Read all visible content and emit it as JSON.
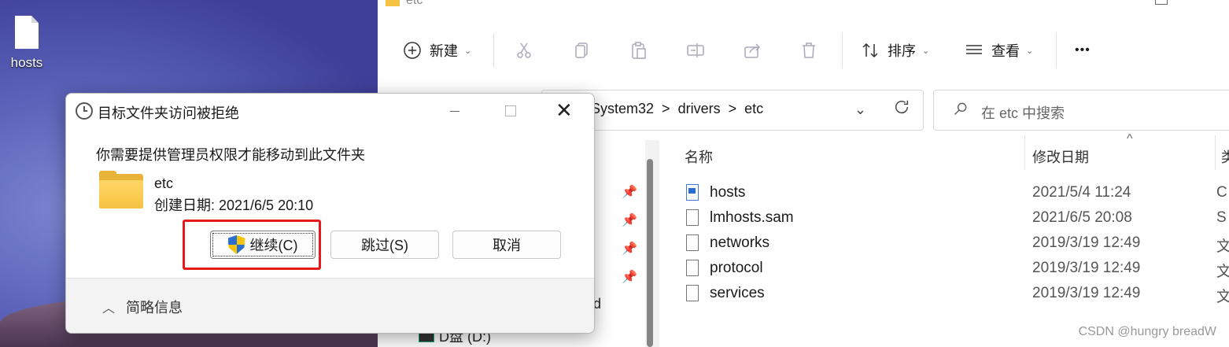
{
  "desktop": {
    "icon_label": "hosts"
  },
  "explorer": {
    "window_title": "etc",
    "toolbar": {
      "new_label": "新建",
      "sort_label": "排序",
      "view_label": "查看",
      "more_label": "•••"
    },
    "address": {
      "crumbs": [
        "System32",
        "drivers",
        "etc"
      ],
      "separator": ">"
    },
    "search": {
      "placeholder": "在 etc 中搜索"
    },
    "nav_partial": [
      "d",
      "D盘 (D:)"
    ],
    "columns": {
      "name": "名称",
      "modified": "修改日期",
      "type": "类"
    },
    "files": [
      {
        "name": "hosts",
        "modified": "2021/5/4 11:24",
        "type": "C",
        "icon": "hosts-file-icon"
      },
      {
        "name": "lmhosts.sam",
        "modified": "2021/6/5 20:08",
        "type": "S",
        "icon": "file-icon"
      },
      {
        "name": "networks",
        "modified": "2019/3/19 12:49",
        "type": "文",
        "icon": "file-icon"
      },
      {
        "name": "protocol",
        "modified": "2019/3/19 12:49",
        "type": "文",
        "icon": "file-icon"
      },
      {
        "name": "services",
        "modified": "2019/3/19 12:49",
        "type": "文",
        "icon": "file-icon"
      }
    ]
  },
  "dialog": {
    "title": "目标文件夹访问被拒绝",
    "message": "你需要提供管理员权限才能移动到此文件夹",
    "folder_name": "etc",
    "folder_created": "创建日期: 2021/6/5 20:10",
    "continue_label": "继续(C)",
    "skip_label": "跳过(S)",
    "cancel_label": "取消",
    "details_label": "简略信息",
    "highlight_color": "#e5191b"
  },
  "watermark": "CSDN @hungry breadW"
}
